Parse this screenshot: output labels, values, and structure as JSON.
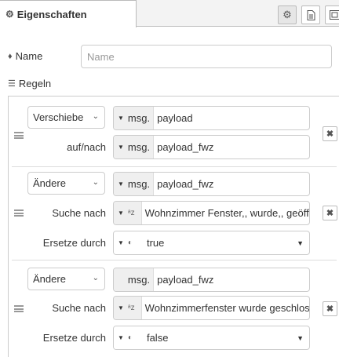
{
  "tab": {
    "title": "Eigenschaften",
    "icon": "gear-icon"
  },
  "toolbar": {
    "buttons": [
      "gear-icon",
      "document-icon",
      "layout-icon"
    ]
  },
  "name": {
    "label": "Name",
    "placeholder": "Name",
    "icon": "tag-icon"
  },
  "rules_section": {
    "label": "Regeln",
    "icon": "list-icon"
  },
  "rules": [
    {
      "action": "Verschiebe",
      "property": {
        "prefix": "msg.",
        "value": "payload"
      },
      "target_label": "auf/nach",
      "target": {
        "prefix": "msg.",
        "value": "payload_fwz"
      }
    },
    {
      "action": "Ändere",
      "property": {
        "prefix": "msg.",
        "value": "payload_fwz"
      },
      "search_label": "Suche nach",
      "search": {
        "type_icon": "az",
        "value": "Wohnzimmer Fenster,, wurde,, geöffnet"
      },
      "replace_label": "Ersetze durch",
      "replace": {
        "type_icon": "boolean",
        "value": "true"
      }
    },
    {
      "action": "Ändere",
      "property": {
        "prefix": "msg.",
        "value": "payload_fwz"
      },
      "search_label": "Suche nach",
      "search": {
        "type_icon": "az",
        "value": "Wohnzimmerfenster wurde geschlossen"
      },
      "replace_label": "Ersetze durch",
      "replace": {
        "type_icon": "boolean",
        "value": "false"
      }
    }
  ]
}
